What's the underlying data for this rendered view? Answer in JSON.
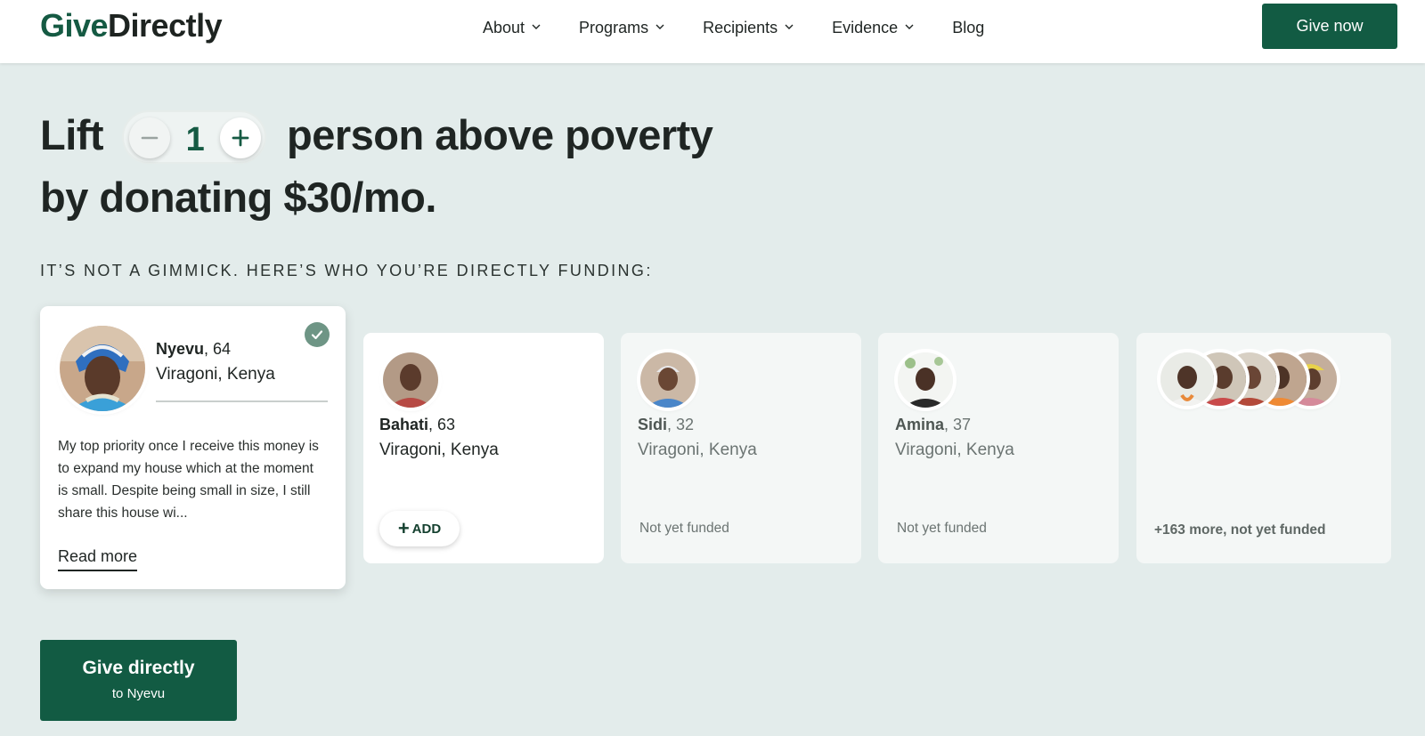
{
  "header": {
    "logo_give": "Give",
    "logo_directly": "Directly",
    "nav": [
      {
        "label": "About",
        "has_dropdown": true
      },
      {
        "label": "Programs",
        "has_dropdown": true
      },
      {
        "label": "Recipients",
        "has_dropdown": true
      },
      {
        "label": "Evidence",
        "has_dropdown": true
      },
      {
        "label": "Blog",
        "has_dropdown": false
      }
    ],
    "cta_label": "Give now"
  },
  "hero": {
    "lift": "Lift",
    "count": "1",
    "rest": "person above poverty",
    "line2": "by donating $30/mo.",
    "subhead": "IT’S NOT A GIMMICK. HERE’S WHO YOU’RE DIRECTLY FUNDING:"
  },
  "recipients": [
    {
      "name": "Nyevu",
      "age": ", 64",
      "place": "Viragoni, Kenya",
      "selected": true,
      "quote": "My top priority once I receive this money is to expand my house which at the moment is small. Despite being small in size, I still share this house wi...",
      "read_more": "Read more"
    },
    {
      "name": "Bahati",
      "age": ", 63",
      "place": "Viragoni, Kenya",
      "add_label": "ADD"
    },
    {
      "name": "Sidi",
      "age": ", 32",
      "place": "Viragoni, Kenya",
      "status": "Not yet funded"
    },
    {
      "name": "Amina",
      "age": ", 37",
      "place": "Viragoni, Kenya",
      "status": "Not yet funded"
    }
  ],
  "more": {
    "label": "+163 more, not yet funded"
  },
  "give_button": {
    "title": "Give directly",
    "subtitle": "to Nyevu"
  },
  "colors": {
    "brand_green": "#125b43",
    "page_bg": "#e3eceb",
    "check_badge": "#6e9585"
  }
}
